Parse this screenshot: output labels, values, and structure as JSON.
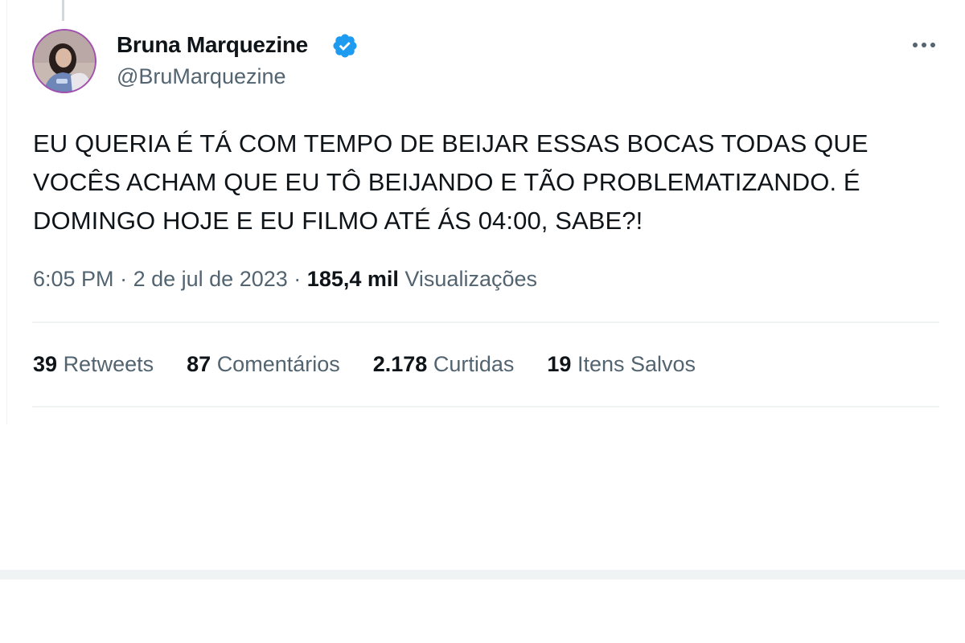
{
  "tweet": {
    "author": {
      "name": "Bruna Marquezine",
      "handle": "@BruMarquezine",
      "verified": true,
      "avatar_icon": "profile-photo"
    },
    "text": "EU QUERIA É TÁ COM TEMPO DE BEIJAR ESSAS BOCAS TODAS QUE VOCÊS ACHAM QUE EU TÔ BEIJANDO E TÃO PROBLEMATIZANDO. É DOMINGO HOJE E EU FILMO ATÉ ÁS 04:00, SABE?!",
    "time": "6:05 PM",
    "separator": "·",
    "date": "2 de jul de 2023",
    "views_count": "185,4 mil",
    "views_label": "Visualizações",
    "more_icon": "more-horizontal-icon",
    "stats": [
      {
        "count": "39",
        "label": "Retweets"
      },
      {
        "count": "87",
        "label": "Comentários"
      },
      {
        "count": "2.178",
        "label": "Curtidas"
      },
      {
        "count": "19",
        "label": "Itens Salvos"
      }
    ]
  },
  "colors": {
    "text_primary": "#0f1419",
    "text_secondary": "#536471",
    "verified_blue": "#1d9bf0",
    "divider": "#eff3f4"
  }
}
